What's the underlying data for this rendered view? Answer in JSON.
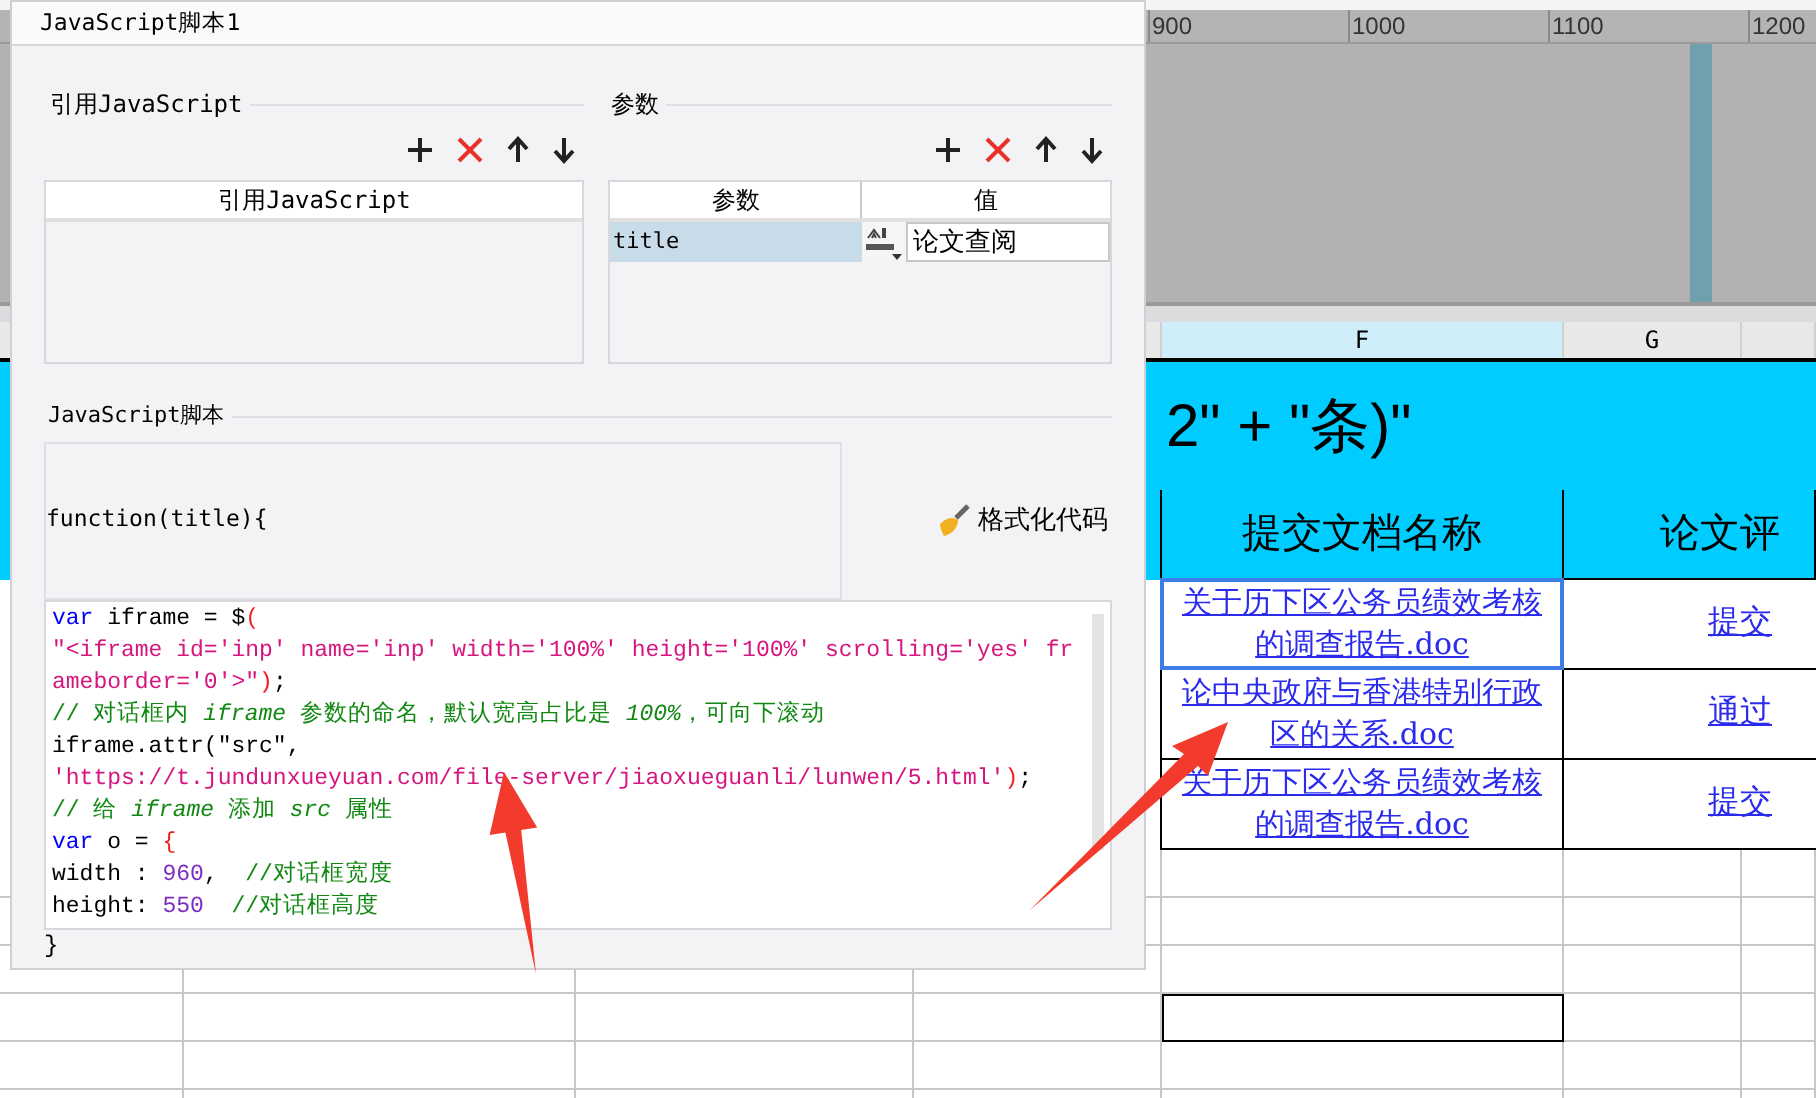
{
  "ruler": {
    "labels": [
      "900",
      "1000",
      "1100",
      "1200"
    ]
  },
  "sheet": {
    "columns": [
      {
        "label": "F",
        "selected": true
      },
      {
        "label": "G",
        "selected": false
      }
    ],
    "banner": "2\" + \"条)\"",
    "header": [
      "提交文档名称",
      "论文评"
    ],
    "rows": [
      {
        "document": "关于历下区公务员绩效考核的调查报告.doc",
        "status": "提交",
        "selected": true
      },
      {
        "document": "论中央政府与香港特别行政区的关系.doc",
        "status": "通过",
        "selected": false
      },
      {
        "document": "关于历下区公务员绩效考核的调查报告.doc",
        "status": "提交",
        "selected": false
      }
    ]
  },
  "dialog": {
    "title": "JavaScript脚本1",
    "references": {
      "label": "引用JavaScript",
      "column": "引用JavaScript"
    },
    "parameters": {
      "label": "参数",
      "columns": [
        "参数",
        "值"
      ],
      "rows": [
        {
          "name": "title",
          "value": "论文查阅",
          "selected": true
        }
      ]
    },
    "script": {
      "label": "JavaScript脚本",
      "signature": "function(title){",
      "format_button": "格式化代码",
      "code": [
        [
          {
            "kind": "keyword",
            "text": "var"
          },
          {
            "kind": "plain",
            "text": " iframe = $"
          },
          {
            "kind": "bracket",
            "text": "("
          }
        ],
        [
          {
            "kind": "string",
            "text": "\"<iframe id='inp' name='inp' width='100%' height='100%' scrolling='yes' fr"
          }
        ],
        [
          {
            "kind": "string",
            "text": "ameborder='0'>\""
          },
          {
            "kind": "bracket",
            "text": ")"
          },
          {
            "kind": "plain",
            "text": ";"
          }
        ],
        [
          {
            "kind": "comment",
            "text": "// 对话框内 *iframe* 参数的命名，默认宽高占比是 *100%*，可向下滚动"
          }
        ],
        [
          {
            "kind": "plain",
            "text": "iframe.attr(\"src\","
          }
        ],
        [
          {
            "kind": "string",
            "text": "'https://t.jundunxueyuan.com/file-server/jiaoxueguanli/lunwen/5.html'"
          },
          {
            "kind": "bracket",
            "text": ")"
          },
          {
            "kind": "plain",
            "text": ";"
          }
        ],
        [
          {
            "kind": "comment",
            "text": "// 给 *iframe* 添加 *src* 属性"
          }
        ],
        [
          {
            "kind": "keyword",
            "text": "var"
          },
          {
            "kind": "plain",
            "text": " o = "
          },
          {
            "kind": "bracket",
            "text": "{"
          }
        ],
        [
          {
            "kind": "plain",
            "text": "width : "
          },
          {
            "kind": "number",
            "text": "960"
          },
          {
            "kind": "plain",
            "text": ",  "
          },
          {
            "kind": "comment",
            "text": "//对话框宽度"
          }
        ],
        [
          {
            "kind": "plain",
            "text": "height: "
          },
          {
            "kind": "number",
            "text": "550"
          },
          {
            "kind": "comment",
            "text": "  //对话框高度"
          }
        ]
      ],
      "closing": "}"
    }
  }
}
